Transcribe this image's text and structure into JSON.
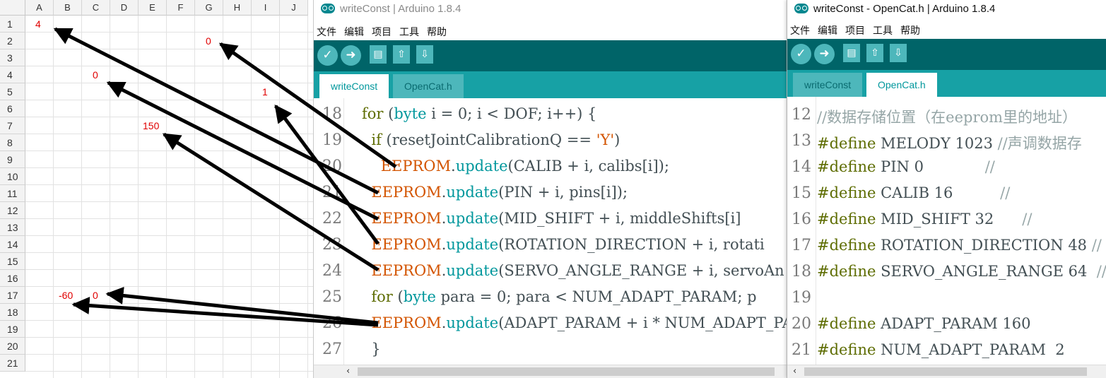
{
  "sheet": {
    "columns": [
      "A",
      "B",
      "C",
      "D",
      "E",
      "F",
      "G",
      "H",
      "I",
      "J"
    ],
    "rows": [
      "1",
      "2",
      "3",
      "4",
      "5",
      "6",
      "7",
      "8",
      "9",
      "10",
      "11",
      "12",
      "13",
      "14",
      "15",
      "16",
      "17",
      "18",
      "19",
      "20",
      "21"
    ],
    "cells": {
      "A1": "4",
      "G2": "0",
      "C4": "0",
      "I5": "1",
      "E7": "150",
      "B17": "-60",
      "C17": "0"
    },
    "value_color": "#e00000"
  },
  "win1": {
    "title": "writeConst | Arduino 1.8.4",
    "menu": [
      "文件",
      "编辑",
      "项目",
      "工具",
      "帮助"
    ],
    "tabs": [
      "writeConst",
      "OpenCat.h"
    ],
    "active_tab": "writeConst",
    "line_numbers": [
      "18",
      "19",
      "20",
      "21",
      "22",
      "23",
      "24",
      "25",
      "26",
      "27"
    ],
    "lines": {
      "l18": "for (byte i = 0; i < DOF; i++) {",
      "l19": "  if (resetJointCalibrationQ == 'Y')",
      "l20": "    EEPROM.update(CALIB + i, calibs[i]);",
      "l21": "  EEPROM.update(PIN + i, pins[i]);",
      "l22": "  EEPROM.update(MID_SHIFT + i, middleShifts[i]",
      "l23": "  EEPROM.update(ROTATION_DIRECTION + i, rotati",
      "l24": "  EEPROM.update(SERVO_ANGLE_RANGE + i, servoAn",
      "l25": "  for (byte para = 0; para < NUM_ADAPT_PARAM; p",
      "l26": "  EEPROM.update(ADAPT_PARAM + i * NUM_ADAPT_PA",
      "l27": "  }"
    }
  },
  "win2": {
    "title": "writeConst - OpenCat.h | Arduino 1.8.4",
    "menu": [
      "文件",
      "编辑",
      "项目",
      "工具",
      "帮助"
    ],
    "tabs": [
      "writeConst",
      "OpenCat.h"
    ],
    "active_tab": "OpenCat.h",
    "line_numbers": [
      "12",
      "13",
      "14",
      "15",
      "16",
      "17",
      "18",
      "19",
      "20",
      "21"
    ],
    "lines": {
      "l12": "//数据存储位置（在eeprom里的地址）",
      "l13a": "#define",
      "l13b": " MELODY 1023 ",
      "l13c": "//声调数据存",
      "l14a": "#define",
      "l14b": " PIN 0             ",
      "l14c": "//",
      "l15a": "#define",
      "l15b": " CALIB 16          ",
      "l15c": "//",
      "l16a": "#define",
      "l16b": " MID_SHIFT 32      ",
      "l16c": "//",
      "l17a": "#define",
      "l17b": " ROTATION_DIRECTION 48 ",
      "l17c": "//",
      "l18a": "#define",
      "l18b": " SERVO_ANGLE_RANGE 64  ",
      "l18c": "//",
      "l20a": "#define",
      "l20b": " ADAPT_PARAM 160",
      "l21a": "#define",
      "l21b": " NUM_ADAPT_PARAM  2"
    }
  },
  "colors": {
    "toolbar": "#006468",
    "tabbar": "#17a1a5",
    "keyword": "#00979c",
    "eeprom": "#d35400",
    "define": "#5e6d03",
    "arrow": "#000000"
  },
  "icons": [
    "verify-icon",
    "upload-icon",
    "new-icon",
    "open-icon",
    "save-icon",
    "arduino-logo-icon",
    "scroll-left-icon"
  ]
}
